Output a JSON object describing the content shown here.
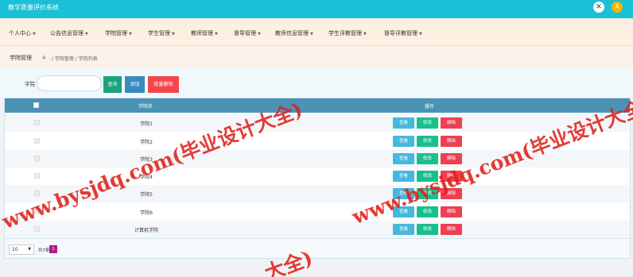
{
  "app": {
    "title": "教学质量评价系统"
  },
  "header": {
    "fullscreen_glyph": "✕",
    "avatar_glyph": "A"
  },
  "nav": {
    "items": [
      {
        "label": "个人中心"
      },
      {
        "label": "公告信息管理"
      },
      {
        "label": "学院管理"
      },
      {
        "label": "学生管理"
      },
      {
        "label": "教师管理"
      },
      {
        "label": "督导管理"
      },
      {
        "label": "教师信息管理"
      },
      {
        "label": "学生评教管理"
      },
      {
        "label": "督导评教管理"
      }
    ]
  },
  "breadcrumb": {
    "title": "学院管理",
    "path": "/ 学院管理 / 学院列表"
  },
  "search": {
    "label": "学院",
    "value": "",
    "search_label": "查询",
    "add_label": "添加",
    "batch_delete_label": "批量删除"
  },
  "table": {
    "headers": {
      "name": "学院名",
      "ops": "操作"
    },
    "rows": [
      {
        "name": "学院1"
      },
      {
        "name": "学院2"
      },
      {
        "name": "学院3"
      },
      {
        "name": "学院4"
      },
      {
        "name": "学院5"
      },
      {
        "name": "学院6"
      },
      {
        "name": "计算机学院"
      }
    ],
    "actions": {
      "view": "查看",
      "edit": "修改",
      "delete": "删除"
    }
  },
  "pagination": {
    "page_size": "10",
    "total_text": "共7条",
    "current_page": "1"
  },
  "watermark": {
    "text": "www.bysjdq.com(毕业设计大全)",
    "partial_text": "大全)"
  },
  "colors": {
    "topbar": "#19c0d6",
    "table_header": "#4a93b5",
    "view": "#45b8dc",
    "edit": "#18c08b",
    "delete": "#f03e52"
  }
}
